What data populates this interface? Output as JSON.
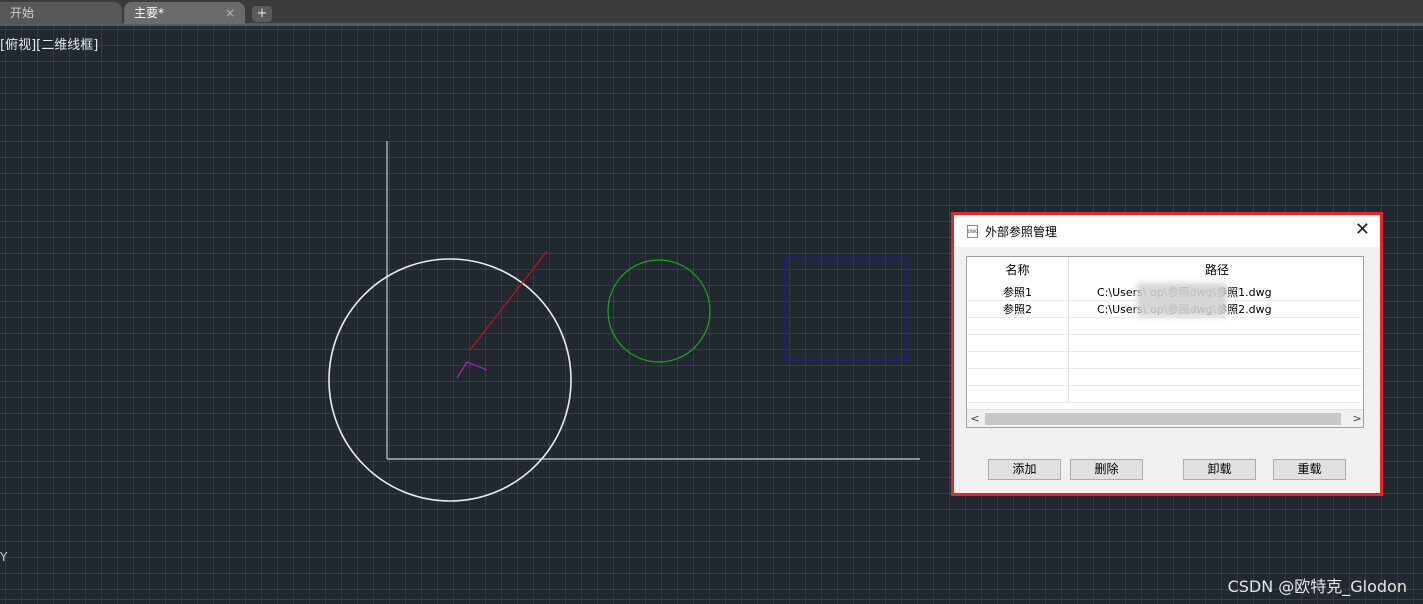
{
  "tabs": [
    {
      "label": "开始"
    },
    {
      "label": "主要*"
    }
  ],
  "tab_close_glyph": "×",
  "tab_add_glyph": "+",
  "viewport_label": "[俯视][二维线框]",
  "ucs_axis_label": "Y",
  "drawing_colors": {
    "axis_lines": "#cfcfcf",
    "large_circle": "#ececec",
    "small_circle": "#1aa81a",
    "rectangle": "#1a1ab0",
    "red_line": "#c0141c",
    "magenta_marker": "#b020c0"
  },
  "dialog": {
    "title": "外部参照管理",
    "icon": "dwg-file-icon",
    "icon_text": "DWG",
    "close_glyph": "✕",
    "columns": {
      "name": "名称",
      "path": "路径"
    },
    "rows": [
      {
        "name": "参照1",
        "path": "C:\\Users\\                    op\\参照dwg\\参照1.dwg"
      },
      {
        "name": "参照2",
        "path": "C:\\Users\\                    op\\参照dwg\\参照2.dwg"
      }
    ],
    "scroll_left_glyph": "<",
    "scroll_right_glyph": ">",
    "buttons": {
      "add": "添加",
      "delete": "删除",
      "unload": "卸载",
      "reload": "重载"
    }
  },
  "watermark": "CSDN @欧特克_Glodon"
}
